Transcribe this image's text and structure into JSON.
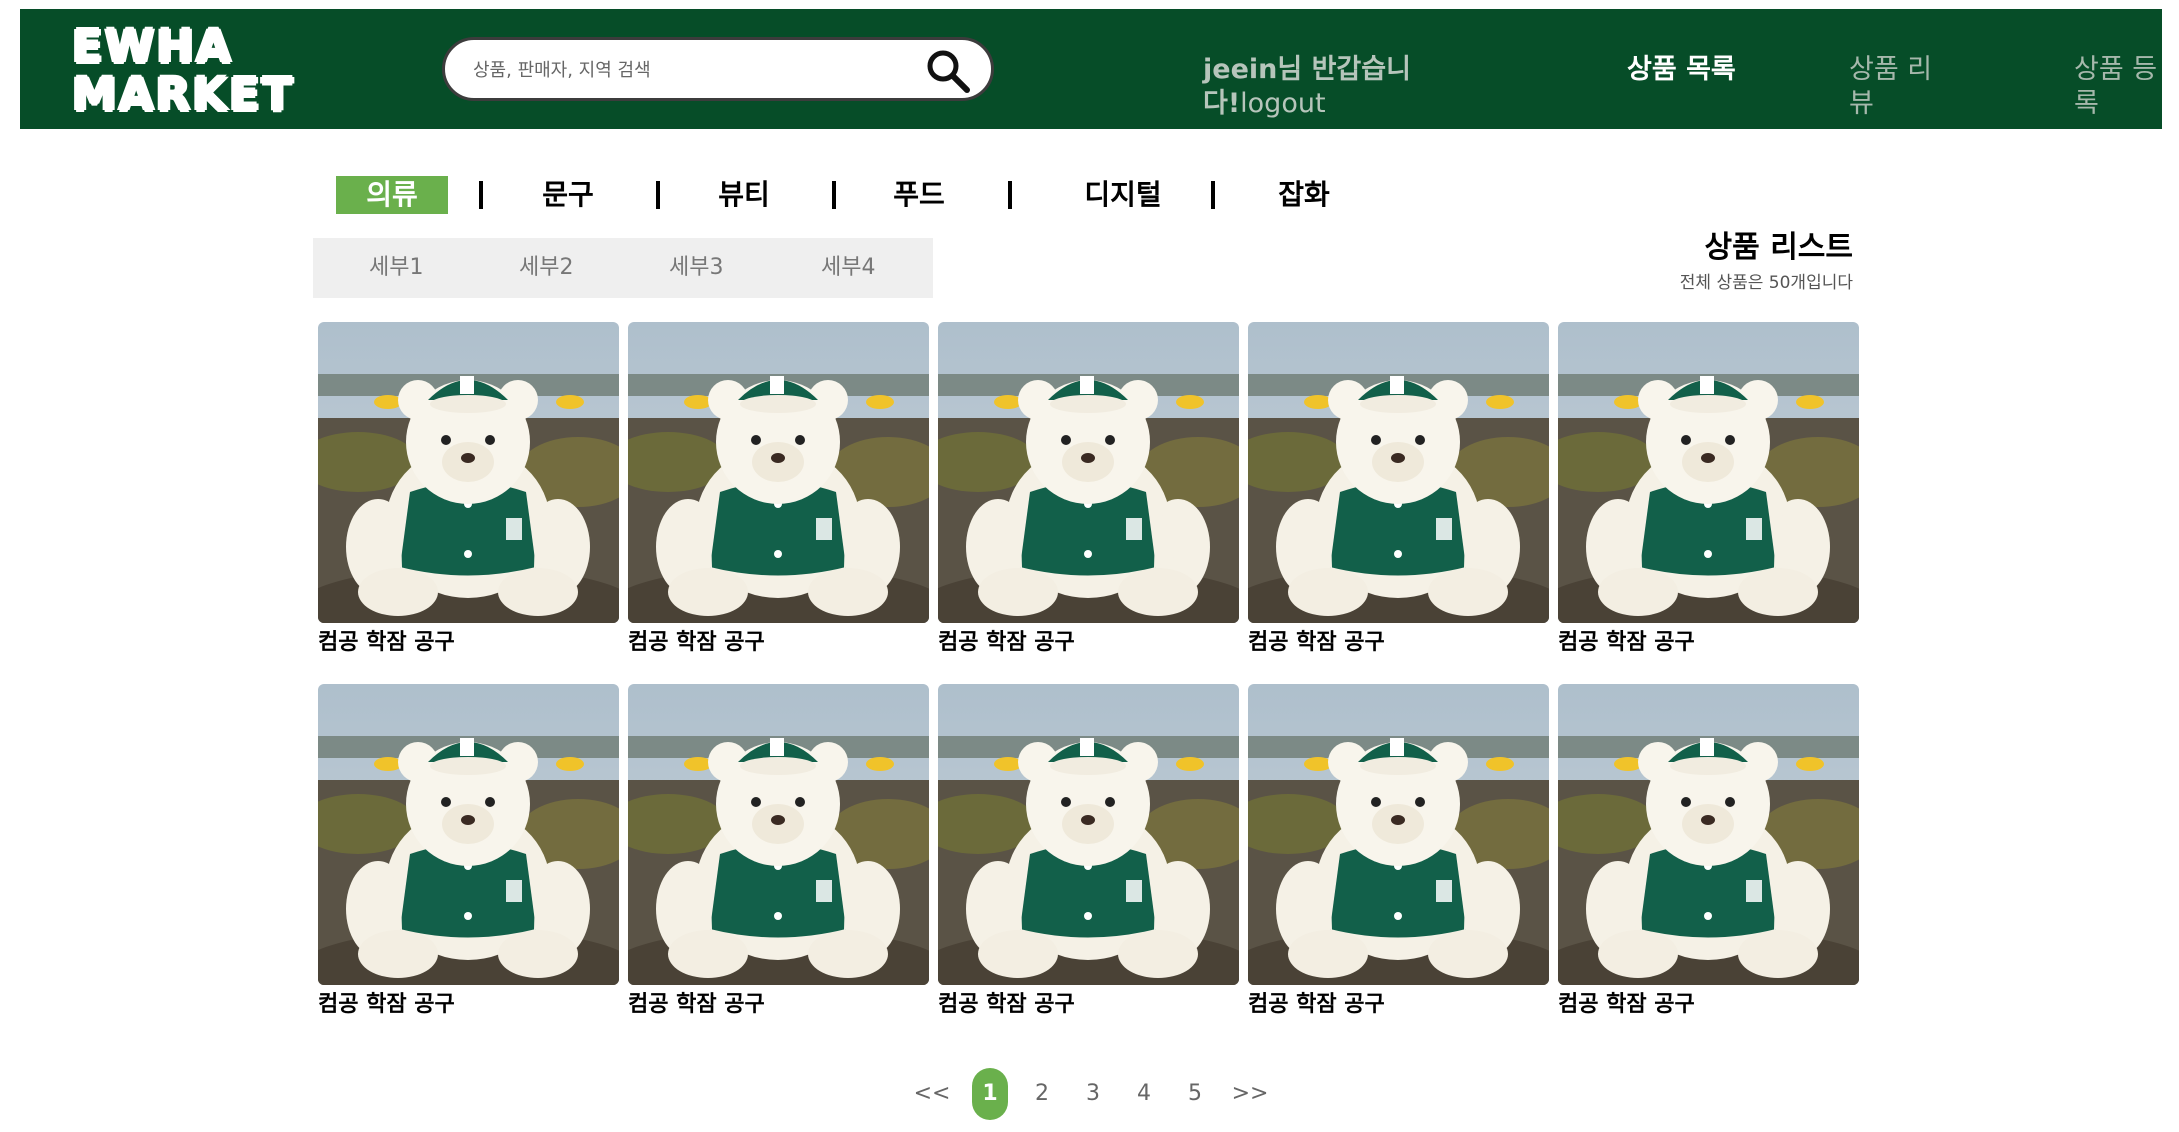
{
  "header": {
    "logo_line1": "EWHA",
    "logo_line2": "MARKET",
    "search_placeholder": "상품, 판매자, 지역 검색",
    "greeting": "jeein님 반갑습니다!",
    "logout": "logout",
    "nav": {
      "product_list": "상품 목록",
      "product_review": "상품 리뷰",
      "product_register": "상품 등록"
    },
    "colors": {
      "background": "#064d28",
      "accent": "#6ab04c"
    }
  },
  "categories": [
    "의류",
    "문구",
    "뷰티",
    "푸드",
    "디지털",
    "잡화"
  ],
  "active_category": "의류",
  "subcategories": [
    "세부1",
    "세부2",
    "세부3",
    "세부4"
  ],
  "list": {
    "title": "상품 리스트",
    "count_text": "전체 상품은 50개입니다"
  },
  "products": [
    {
      "name": "컴공 학잠 공구",
      "image": "green-varsity-teddy-bear"
    },
    {
      "name": "컴공 학잠 공구",
      "image": "green-varsity-teddy-bear"
    },
    {
      "name": "컴공 학잠 공구",
      "image": "green-varsity-teddy-bear"
    },
    {
      "name": "컴공 학잠 공구",
      "image": "green-varsity-teddy-bear"
    },
    {
      "name": "컴공 학잠 공구",
      "image": "green-varsity-teddy-bear"
    },
    {
      "name": "컴공 학잠 공구",
      "image": "green-varsity-teddy-bear"
    },
    {
      "name": "컴공 학잠 공구",
      "image": "green-varsity-teddy-bear"
    },
    {
      "name": "컴공 학잠 공구",
      "image": "green-varsity-teddy-bear"
    },
    {
      "name": "컴공 학잠 공구",
      "image": "green-varsity-teddy-bear"
    },
    {
      "name": "컴공 학잠 공구",
      "image": "green-varsity-teddy-bear"
    }
  ],
  "pagination": {
    "prev": "<<",
    "pages": [
      "1",
      "2",
      "3",
      "4",
      "5"
    ],
    "current": "1",
    "next": ">>"
  }
}
